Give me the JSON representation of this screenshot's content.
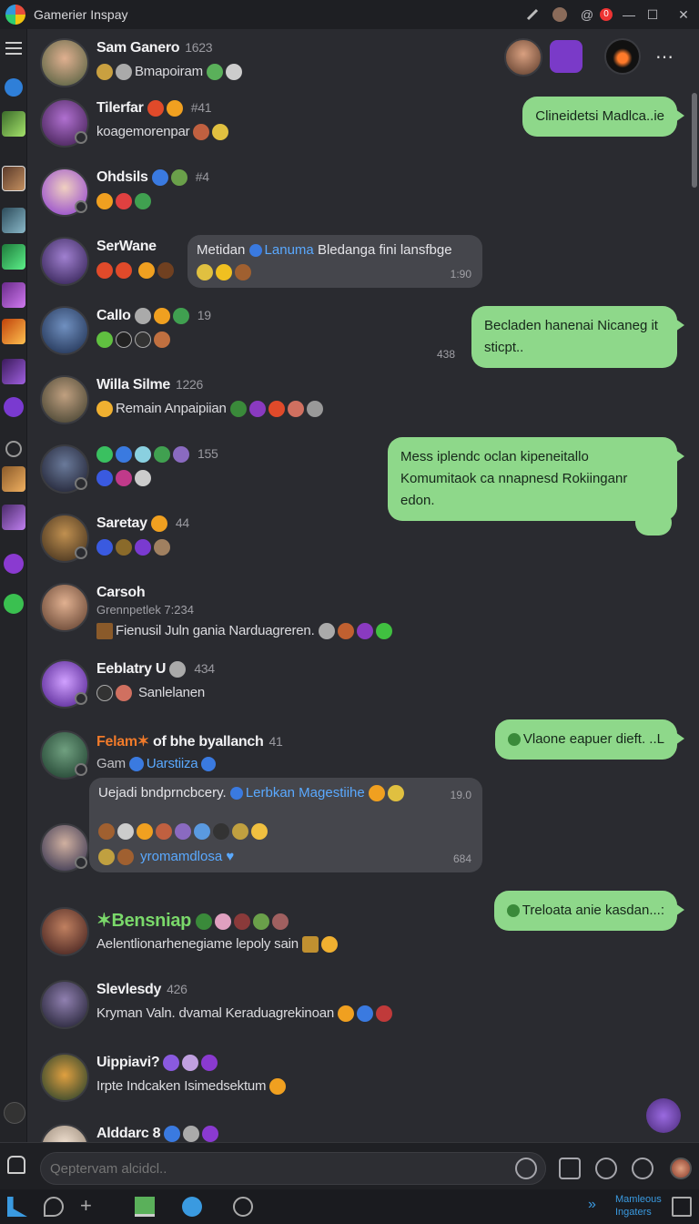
{
  "app": {
    "title": "Gamerier Inspay",
    "notif_count": "0"
  },
  "messages": [
    {
      "name": "Sam Ganero",
      "extra": "1623",
      "text": "Bmapoiram"
    },
    {
      "name": "Tilerfar",
      "extra": "#41",
      "text": "koagemorenpar"
    },
    {
      "name": "Ohdsils",
      "extra": "#4",
      "text": ""
    },
    {
      "name": "SerWane",
      "extra": "",
      "text": ""
    },
    {
      "name": "Callo",
      "extra": "19",
      "text": ""
    },
    {
      "name": "Willa Silme",
      "extra": "1226",
      "text": "Remain Anpaipiian"
    },
    {
      "name": "",
      "extra": "155",
      "text": ""
    },
    {
      "name": "Saretay",
      "extra": "44",
      "text": ""
    },
    {
      "name": "Carsoh",
      "extra": "",
      "subline": "Grennpetlek 7:234",
      "text": "Fienusil Juln gania Narduagreren."
    },
    {
      "name": "Eeblatry U",
      "extra": "434",
      "text": "Sanlelanen"
    },
    {
      "name_accent": "Felam",
      "name": "of bhe byallanch",
      "extra": "41",
      "text": "Gam",
      "link": "Uarstiiza"
    },
    {
      "name": "",
      "extra": "",
      "text": ""
    },
    {
      "name": "Bensniap",
      "extra": "",
      "text": "Aelentlionarhenegiame lepoly sain"
    },
    {
      "name": "Slevlesdy",
      "extra": "426",
      "text": "Kryman Valn. dvamal Keraduagrekinoan"
    },
    {
      "name": "Uippiavi?",
      "extra": "",
      "text": "Irpte Indcaken Isimedsektum"
    },
    {
      "name": "Alddarc 8",
      "extra": "",
      "text": ""
    }
  ],
  "bubbles_right": [
    {
      "text": "Clineidetsi Madlca..ie"
    },
    {
      "text": "Becladen hanenai Nicaneg it sticpt..",
      "time": "438"
    },
    {
      "text": "Mess iplendc  oclan kipeneitallo Komumitaok ca nnapnesd Rokiinganr edon."
    },
    {
      "text": "Vlaone eapuer dieft. ..L"
    },
    {
      "text": "Treloata anie kasdan...:"
    }
  ],
  "quote1": {
    "author": "Metidan",
    "link": "Lanuma",
    "text": "Bledanga fini lansfbge",
    "time": "1:90"
  },
  "quote2": {
    "title": "Uejadi bndprncbcery.",
    "link": "Lerbkan Magestiihe",
    "time": "19.0",
    "footer": "yromamdlosa",
    "count": "684"
  },
  "composer": {
    "placeholder": "Qeptervam alcidcl.."
  },
  "bottom": {
    "label1": "Mamleous",
    "label2": "Ingaters"
  },
  "colors": {
    "accent_green": "#8ed88a",
    "bg": "#2a2b30",
    "link_blue": "#5aa9ff"
  }
}
